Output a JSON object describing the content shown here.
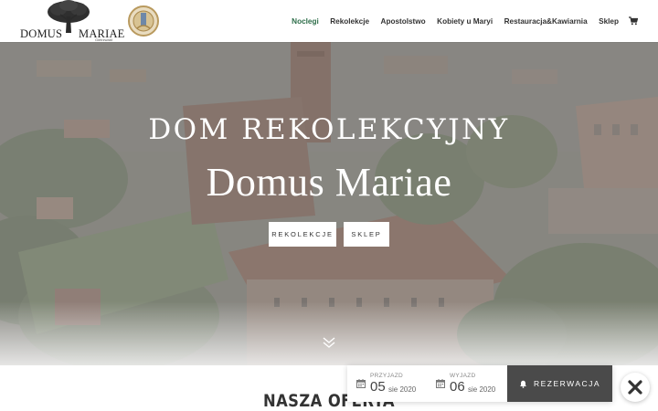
{
  "logo": {
    "left_word": "DOMUS",
    "right_word": "MARIAE",
    "sub_word": "Gietrzwałd"
  },
  "nav": {
    "items": [
      {
        "label": "Noclegi",
        "active": true
      },
      {
        "label": "Rekolekcje",
        "active": false
      },
      {
        "label": "Apostolstwo",
        "active": false
      },
      {
        "label": "Kobiety u Maryi",
        "active": false
      },
      {
        "label": "Restauracja&Kawiarnia",
        "active": false
      },
      {
        "label": "Sklep",
        "active": false
      }
    ],
    "cart_icon": "cart-icon",
    "active_color": "#2e6e4a"
  },
  "hero": {
    "title": "DOM REKOLEKCYJNY",
    "subtitle": "Domus Mariae",
    "buttons": [
      "REKOLEKCJE",
      "SKLEP"
    ],
    "scroll_icon": "double-chevron-down-icon"
  },
  "section": {
    "title": "NASZA OFERTA"
  },
  "booking": {
    "checkin": {
      "label": "PRZYJAZD",
      "day": "05",
      "month_year": "sie 2020"
    },
    "checkout": {
      "label": "WYJAZD",
      "day": "06",
      "month_year": "sie 2020"
    },
    "reserve_label": "REZERWACJA",
    "reserve_icon": "bell-icon",
    "button_color": "#4a4a4a"
  },
  "close_icon": "close-icon"
}
